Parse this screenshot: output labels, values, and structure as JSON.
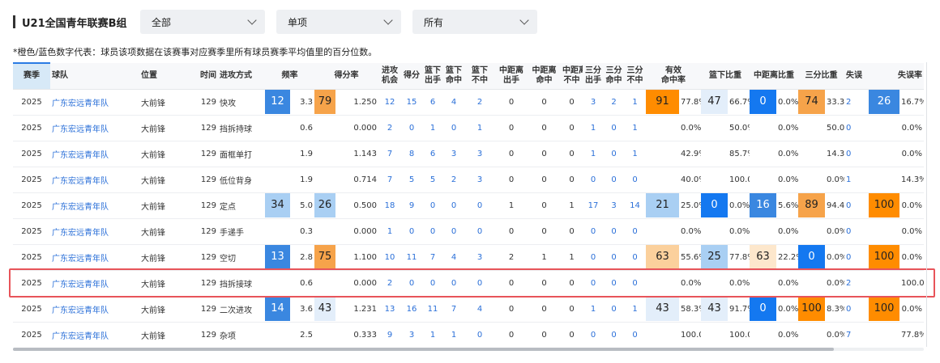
{
  "header": {
    "title": "U21全国青年联赛B组",
    "filters": [
      {
        "id": "dd1",
        "value": "全部"
      },
      {
        "id": "dd2",
        "value": "单项"
      },
      {
        "id": "dd3",
        "value": "所有"
      }
    ],
    "note": "*橙色/蓝色数字代表：球员该项数据在该赛事对应赛季里所有球员赛季平均值里的百分位数。"
  },
  "colors": {
    "deep_blue": "#1478f0",
    "mid_blue": "#3a87e0",
    "light_blue": "#a9cff3",
    "pale_blue": "#e3eefa",
    "deep_orange": "#ff8c00",
    "mid_orange": "#f6a34a",
    "light_orange": "#fbd09c",
    "pale_orange": "#fde7cc",
    "highlight_border": "#e8545a"
  },
  "table": {
    "columns": [
      {
        "key": "season",
        "label": [
          "赛季"
        ]
      },
      {
        "key": "team",
        "label": [
          "球队"
        ]
      },
      {
        "key": "position",
        "label": [
          "位置"
        ]
      },
      {
        "key": "time",
        "label": [
          "时间"
        ]
      },
      {
        "key": "mode",
        "label": [
          "进攻方式"
        ]
      },
      {
        "key": "freq",
        "label": [
          "频率"
        ]
      },
      {
        "key": "ppp",
        "label": [
          "得分率"
        ]
      },
      {
        "key": "poss",
        "label": [
          "进攻",
          "机会"
        ]
      },
      {
        "key": "pts",
        "label": [
          "得分"
        ]
      },
      {
        "key": "rim_att",
        "label": [
          "篮下",
          "出手"
        ]
      },
      {
        "key": "rim_made",
        "label": [
          "篮下",
          "命中"
        ]
      },
      {
        "key": "rim_miss",
        "label": [
          "篮下",
          "不中"
        ]
      },
      {
        "key": "mid_att",
        "label": [
          "中距离",
          "出手"
        ]
      },
      {
        "key": "mid_made",
        "label": [
          "中距离",
          "命中"
        ]
      },
      {
        "key": "mid_miss",
        "label": [
          "中距离",
          "不中"
        ]
      },
      {
        "key": "three_att",
        "label": [
          "三分",
          "出手"
        ]
      },
      {
        "key": "three_made",
        "label": [
          "三分",
          "命中"
        ]
      },
      {
        "key": "three_miss",
        "label": [
          "三分",
          "不中"
        ]
      },
      {
        "key": "efg",
        "label": [
          "有效",
          "命中率"
        ]
      },
      {
        "key": "rim_ratio",
        "label": [
          "篮下比重"
        ]
      },
      {
        "key": "mid_ratio",
        "label": [
          "中距离比重"
        ]
      },
      {
        "key": "three_ratio",
        "label": [
          "三分比重"
        ]
      },
      {
        "key": "tov",
        "label": [
          "失误"
        ]
      },
      {
        "key": "tov_rate",
        "label": [
          "失误率"
        ]
      }
    ],
    "rows": [
      {
        "season": "2025",
        "team": "广东宏远青年队",
        "position": "大前锋",
        "time": "129",
        "mode": "快攻",
        "freq": {
          "badge": "12",
          "color": "mid_blue",
          "value": "3.3"
        },
        "ppp": {
          "badge": "79",
          "color": "mid_orange",
          "value": "1.250"
        },
        "poss": "12",
        "pts": "15",
        "rim_att": "6",
        "rim_made": "4",
        "rim_miss": "2",
        "mid_att": "0",
        "mid_made": "0",
        "mid_miss": "0",
        "three_att": "3",
        "three_made": "2",
        "three_miss": "1",
        "efg": {
          "badge": "91",
          "color": "deep_orange",
          "value": "77.8%"
        },
        "rim_ratio": {
          "badge": "47",
          "color": "pale_blue",
          "value": "66.7%"
        },
        "mid_ratio": {
          "badge": "0",
          "color": "deep_blue",
          "value": "0.0%"
        },
        "three_ratio": {
          "badge": "74",
          "color": "mid_orange",
          "value": "33.3%"
        },
        "tov": {
          "badge": "",
          "color": "",
          "value": "2"
        },
        "tov_rate": {
          "badge": "26",
          "color": "mid_blue",
          "value": "16.7%"
        }
      },
      {
        "season": "2025",
        "team": "广东宏远青年队",
        "position": "大前锋",
        "time": "129",
        "mode": "挡拆持球",
        "freq": {
          "badge": "",
          "color": "",
          "value": "0.6"
        },
        "ppp": {
          "badge": "",
          "color": "",
          "value": "0.000"
        },
        "poss": "2",
        "pts": "0",
        "rim_att": "1",
        "rim_made": "0",
        "rim_miss": "1",
        "mid_att": "0",
        "mid_made": "0",
        "mid_miss": "0",
        "three_att": "1",
        "three_made": "0",
        "three_miss": "1",
        "efg": {
          "badge": "",
          "color": "",
          "value": "0.0%"
        },
        "rim_ratio": {
          "badge": "",
          "color": "",
          "value": "50.0%"
        },
        "mid_ratio": {
          "badge": "",
          "color": "",
          "value": "0.0%"
        },
        "three_ratio": {
          "badge": "",
          "color": "",
          "value": "50.0%"
        },
        "tov": {
          "badge": "",
          "color": "",
          "value": "0"
        },
        "tov_rate": {
          "badge": "",
          "color": "",
          "value": "0.0%"
        }
      },
      {
        "season": "2025",
        "team": "广东宏远青年队",
        "position": "大前锋",
        "time": "129",
        "mode": "面框单打",
        "freq": {
          "badge": "",
          "color": "",
          "value": "1.9"
        },
        "ppp": {
          "badge": "",
          "color": "",
          "value": "1.143"
        },
        "poss": "7",
        "pts": "8",
        "rim_att": "6",
        "rim_made": "3",
        "rim_miss": "3",
        "mid_att": "0",
        "mid_made": "0",
        "mid_miss": "0",
        "three_att": "1",
        "three_made": "0",
        "three_miss": "1",
        "efg": {
          "badge": "",
          "color": "",
          "value": "42.9%"
        },
        "rim_ratio": {
          "badge": "",
          "color": "",
          "value": "85.7%"
        },
        "mid_ratio": {
          "badge": "",
          "color": "",
          "value": "0.0%"
        },
        "three_ratio": {
          "badge": "",
          "color": "",
          "value": "14.3%"
        },
        "tov": {
          "badge": "",
          "color": "",
          "value": "0"
        },
        "tov_rate": {
          "badge": "",
          "color": "",
          "value": "0.0%"
        }
      },
      {
        "season": "2025",
        "team": "广东宏远青年队",
        "position": "大前锋",
        "time": "129",
        "mode": "低位背身",
        "freq": {
          "badge": "",
          "color": "",
          "value": "1.9"
        },
        "ppp": {
          "badge": "",
          "color": "",
          "value": "0.714"
        },
        "poss": "7",
        "pts": "5",
        "rim_att": "5",
        "rim_made": "2",
        "rim_miss": "3",
        "mid_att": "0",
        "mid_made": "0",
        "mid_miss": "0",
        "three_att": "0",
        "three_made": "0",
        "three_miss": "0",
        "efg": {
          "badge": "",
          "color": "",
          "value": "40.0%"
        },
        "rim_ratio": {
          "badge": "",
          "color": "",
          "value": "100.0%"
        },
        "mid_ratio": {
          "badge": "",
          "color": "",
          "value": "0.0%"
        },
        "three_ratio": {
          "badge": "",
          "color": "",
          "value": "0.0%"
        },
        "tov": {
          "badge": "",
          "color": "",
          "value": "1"
        },
        "tov_rate": {
          "badge": "",
          "color": "",
          "value": "14.3%"
        }
      },
      {
        "season": "2025",
        "team": "广东宏远青年队",
        "position": "大前锋",
        "time": "129",
        "mode": "定点",
        "freq": {
          "badge": "34",
          "color": "light_blue",
          "value": "5.0"
        },
        "ppp": {
          "badge": "26",
          "color": "light_blue",
          "value": "0.500"
        },
        "poss": "18",
        "pts": "9",
        "rim_att": "0",
        "rim_made": "0",
        "rim_miss": "0",
        "mid_att": "1",
        "mid_made": "0",
        "mid_miss": "1",
        "three_att": "17",
        "three_made": "3",
        "three_miss": "14",
        "efg": {
          "badge": "21",
          "color": "light_blue",
          "value": "25.0%"
        },
        "rim_ratio": {
          "badge": "0",
          "color": "deep_blue",
          "value": "0.0%"
        },
        "mid_ratio": {
          "badge": "16",
          "color": "mid_blue",
          "value": "5.6%"
        },
        "three_ratio": {
          "badge": "89",
          "color": "mid_orange",
          "value": "94.4%"
        },
        "tov": {
          "badge": "",
          "color": "",
          "value": "0"
        },
        "tov_rate": {
          "badge": "100",
          "color": "deep_orange",
          "value": "0.0%"
        }
      },
      {
        "season": "2025",
        "team": "广东宏远青年队",
        "position": "大前锋",
        "time": "129",
        "mode": "手递手",
        "freq": {
          "badge": "",
          "color": "",
          "value": "0.3"
        },
        "ppp": {
          "badge": "",
          "color": "",
          "value": "0.000"
        },
        "poss": "1",
        "pts": "0",
        "rim_att": "0",
        "rim_made": "0",
        "rim_miss": "0",
        "mid_att": "0",
        "mid_made": "0",
        "mid_miss": "0",
        "three_att": "0",
        "three_made": "0",
        "three_miss": "0",
        "efg": {
          "badge": "",
          "color": "",
          "value": "0.0%"
        },
        "rim_ratio": {
          "badge": "",
          "color": "",
          "value": "0.0%"
        },
        "mid_ratio": {
          "badge": "",
          "color": "",
          "value": "0.0%"
        },
        "three_ratio": {
          "badge": "",
          "color": "",
          "value": "0.0%"
        },
        "tov": {
          "badge": "",
          "color": "",
          "value": "0"
        },
        "tov_rate": {
          "badge": "",
          "color": "",
          "value": "0.0%"
        }
      },
      {
        "season": "2025",
        "team": "广东宏远青年队",
        "position": "大前锋",
        "time": "129",
        "mode": "空切",
        "freq": {
          "badge": "13",
          "color": "mid_blue",
          "value": "2.8"
        },
        "ppp": {
          "badge": "75",
          "color": "mid_orange",
          "value": "1.100"
        },
        "poss": "10",
        "pts": "11",
        "rim_att": "7",
        "rim_made": "4",
        "rim_miss": "3",
        "mid_att": "2",
        "mid_made": "1",
        "mid_miss": "1",
        "three_att": "0",
        "three_made": "0",
        "three_miss": "0",
        "efg": {
          "badge": "63",
          "color": "light_orange",
          "value": "55.6%"
        },
        "rim_ratio": {
          "badge": "25",
          "color": "light_blue",
          "value": "77.8%"
        },
        "mid_ratio": {
          "badge": "63",
          "color": "pale_orange",
          "value": "22.2%"
        },
        "three_ratio": {
          "badge": "0",
          "color": "deep_blue",
          "value": "0.0%"
        },
        "tov": {
          "badge": "",
          "color": "",
          "value": "0"
        },
        "tov_rate": {
          "badge": "100",
          "color": "deep_orange",
          "value": "0.0%"
        }
      },
      {
        "season": "2025",
        "team": "广东宏远青年队",
        "position": "大前锋",
        "time": "129",
        "mode": "挡拆接球",
        "freq": {
          "badge": "",
          "color": "",
          "value": "0.6"
        },
        "ppp": {
          "badge": "",
          "color": "",
          "value": "0.000"
        },
        "poss": "2",
        "pts": "0",
        "rim_att": "0",
        "rim_made": "0",
        "rim_miss": "0",
        "mid_att": "0",
        "mid_made": "0",
        "mid_miss": "0",
        "three_att": "0",
        "three_made": "0",
        "three_miss": "0",
        "efg": {
          "badge": "",
          "color": "",
          "value": "0.0%"
        },
        "rim_ratio": {
          "badge": "",
          "color": "",
          "value": "0.0%"
        },
        "mid_ratio": {
          "badge": "",
          "color": "",
          "value": "0.0%"
        },
        "three_ratio": {
          "badge": "",
          "color": "",
          "value": "0.0%"
        },
        "tov": {
          "badge": "",
          "color": "",
          "value": "2"
        },
        "tov_rate": {
          "badge": "",
          "color": "",
          "value": "100.0%"
        }
      },
      {
        "season": "2025",
        "team": "广东宏远青年队",
        "position": "大前锋",
        "time": "129",
        "mode": "二次进攻",
        "freq": {
          "badge": "14",
          "color": "mid_blue",
          "value": "3.6"
        },
        "ppp": {
          "badge": "43",
          "color": "pale_blue",
          "value": "1.231"
        },
        "poss": "13",
        "pts": "16",
        "rim_att": "11",
        "rim_made": "7",
        "rim_miss": "4",
        "mid_att": "0",
        "mid_made": "0",
        "mid_miss": "0",
        "three_att": "1",
        "three_made": "0",
        "three_miss": "1",
        "efg": {
          "badge": "43",
          "color": "pale_blue",
          "value": "58.3%"
        },
        "rim_ratio": {
          "badge": "43",
          "color": "pale_blue",
          "value": "91.7%"
        },
        "mid_ratio": {
          "badge": "0",
          "color": "deep_blue",
          "value": "0.0%"
        },
        "three_ratio": {
          "badge": "100",
          "color": "deep_orange",
          "value": "8.3%"
        },
        "tov": {
          "badge": "",
          "color": "",
          "value": "0"
        },
        "tov_rate": {
          "badge": "100",
          "color": "deep_orange",
          "value": "0.0%"
        }
      },
      {
        "season": "2025",
        "team": "广东宏远青年队",
        "position": "大前锋",
        "time": "129",
        "mode": "杂项",
        "freq": {
          "badge": "",
          "color": "",
          "value": "2.5"
        },
        "ppp": {
          "badge": "",
          "color": "",
          "value": "0.333"
        },
        "poss": "9",
        "pts": "3",
        "rim_att": "1",
        "rim_made": "1",
        "rim_miss": "0",
        "mid_att": "0",
        "mid_made": "0",
        "mid_miss": "0",
        "three_att": "0",
        "three_made": "0",
        "three_miss": "0",
        "efg": {
          "badge": "",
          "color": "",
          "value": "100.0%"
        },
        "rim_ratio": {
          "badge": "",
          "color": "",
          "value": "100.0%"
        },
        "mid_ratio": {
          "badge": "",
          "color": "",
          "value": "0.0%"
        },
        "three_ratio": {
          "badge": "",
          "color": "",
          "value": "0.0%"
        },
        "tov": {
          "badge": "",
          "color": "",
          "value": "7"
        },
        "tov_rate": {
          "badge": "",
          "color": "",
          "value": "77.8%"
        }
      }
    ],
    "highlighted_row": 7
  }
}
